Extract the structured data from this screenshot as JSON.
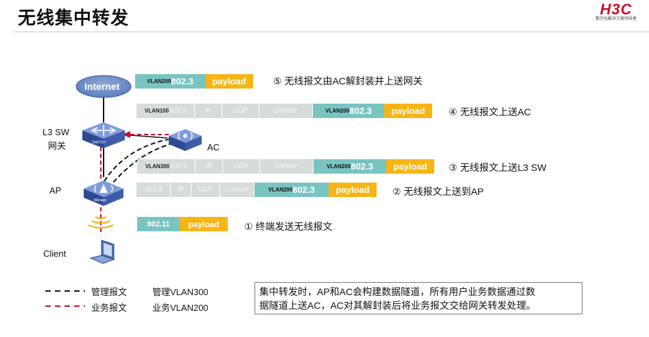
{
  "title": "无线集中转发",
  "logo": {
    "mark": "H3C",
    "tagline": "数字化解决方案领导者"
  },
  "nodes": {
    "internet": "Internet",
    "l3sw_line1": "L3 SW",
    "l3sw_line2": "网关",
    "ac": "AC",
    "ap": "AP",
    "client": "Client",
    "switch_caption": "SWITCH",
    "ap_caption": "Manage"
  },
  "rows": {
    "r5": {
      "vlan": "VLAN200",
      "dot3": "802.3",
      "payload": "payload",
      "step": "⑤  无线报文由AC解封装并上送网关"
    },
    "r4": {
      "vlan_outer": "VLAN100",
      "dot3_outer": "802.3",
      "ip": "IP",
      "udp": "UDP",
      "capwap": "CAPWAP",
      "vlan_inner": "VLAN200",
      "dot3_inner": "802.3",
      "payload": "payload",
      "step": "④  无线报文上送AC"
    },
    "r3": {
      "vlan_outer": "VLAN300",
      "dot3_outer": "802.3",
      "ip": "IP",
      "udp": "UDP",
      "capwap": "CAPWAP",
      "vlan_inner": "VLAN200",
      "dot3_inner": "802.3",
      "payload": "payload",
      "step": "③  无线报文上送L3 SW"
    },
    "r2": {
      "dot3_outer": "802.3",
      "ip": "IP",
      "udp": "UDP",
      "capwap": "CAPWAP",
      "vlan_inner": "VLAN200",
      "dot3_inner": "802.3",
      "payload": "payload",
      "step": "②  无线报文上送到AP"
    },
    "r1": {
      "dot11": "802.11",
      "payload": "payload",
      "step": "①  终端发送无线报文"
    }
  },
  "legend": {
    "mgmt_label": "管理报文",
    "mgmt_vlan": "管理VLAN300",
    "biz_label": "业务报文",
    "biz_vlan": "业务VLAN200"
  },
  "note": {
    "line1": "集中转发时，AP和AC会构建数据隧道，所有用户业务数据通过数",
    "line2": "据隧道上送AC，AC对其解封装后将业务报文交给网关转发处理。"
  },
  "colors": {
    "teal": "#79c4c0",
    "orange": "#f6b513",
    "gray": "#d6dcd9",
    "device": "#3b5aa8",
    "red_dash": "#c8102e"
  }
}
